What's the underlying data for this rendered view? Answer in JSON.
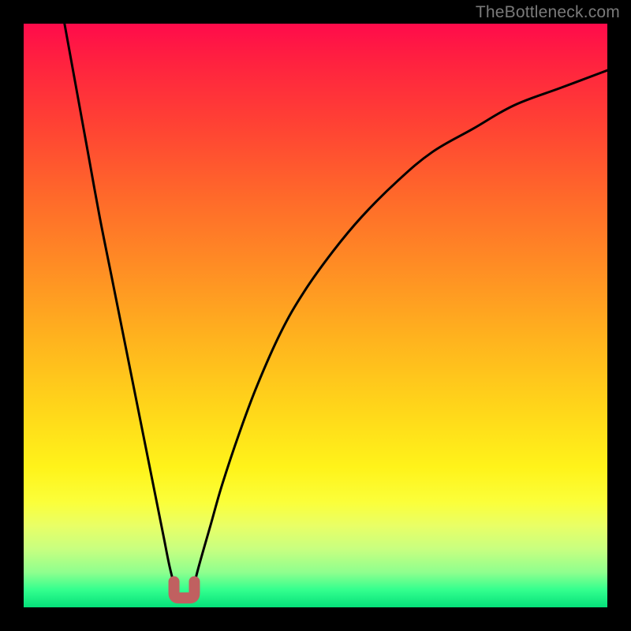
{
  "watermark": "TheBottleneck.com",
  "colors": {
    "background": "#000000",
    "curve_stroke": "#000000",
    "marker_stroke": "#c06060",
    "marker_fill": "none"
  },
  "chart_data": {
    "type": "line",
    "title": "",
    "xlabel": "",
    "ylabel": "",
    "xlim": [
      0,
      100
    ],
    "ylim": [
      0,
      100
    ],
    "grid": false,
    "legend": false,
    "series": [
      {
        "name": "left-branch",
        "x": [
          7,
          9,
          11,
          13,
          15,
          17,
          19,
          20,
          21,
          22,
          23,
          24,
          25,
          26
        ],
        "values": [
          100,
          89,
          78,
          67,
          57,
          47,
          37,
          32,
          27,
          22,
          17,
          12,
          7,
          3
        ]
      },
      {
        "name": "right-branch",
        "x": [
          29,
          30,
          32,
          34,
          37,
          40,
          44,
          48,
          53,
          58,
          64,
          70,
          77,
          84,
          92,
          100
        ],
        "values": [
          3,
          7,
          14,
          21,
          30,
          38,
          47,
          54,
          61,
          67,
          73,
          78,
          82,
          86,
          89,
          92
        ]
      }
    ],
    "marker": {
      "name": "valley-marker",
      "x_center": 27.5,
      "y": 2,
      "width": 3.5
    }
  }
}
